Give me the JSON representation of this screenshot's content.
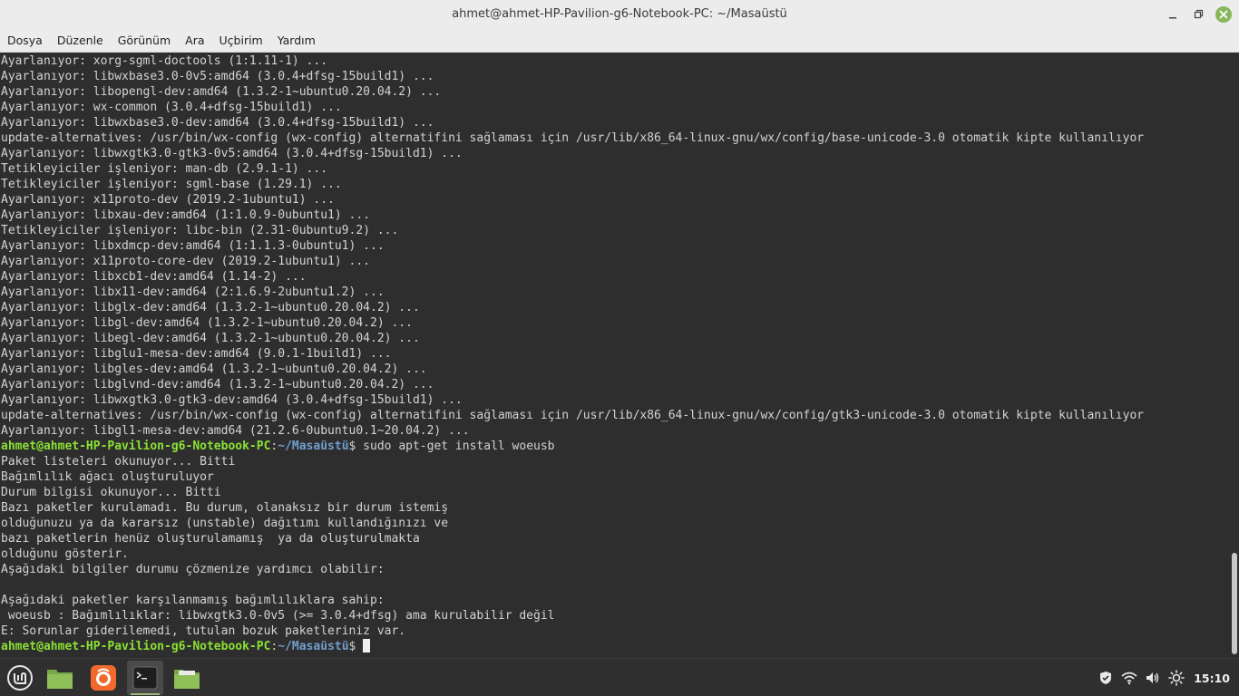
{
  "window": {
    "title": "ahmet@ahmet-HP-Pavilion-g6-Notebook-PC: ~/Masaüstü"
  },
  "menu": [
    "Dosya",
    "Düzenle",
    "Görünüm",
    "Ara",
    "Uçbirim",
    "Yardım"
  ],
  "terminal": {
    "lines": [
      {
        "type": "out",
        "text": "Ayarlanıyor: xorg-sgml-doctools (1:1.11-1) ..."
      },
      {
        "type": "out",
        "text": "Ayarlanıyor: libwxbase3.0-0v5:amd64 (3.0.4+dfsg-15build1) ..."
      },
      {
        "type": "out",
        "text": "Ayarlanıyor: libopengl-dev:amd64 (1.3.2-1~ubuntu0.20.04.2) ..."
      },
      {
        "type": "out",
        "text": "Ayarlanıyor: wx-common (3.0.4+dfsg-15build1) ..."
      },
      {
        "type": "out",
        "text": "Ayarlanıyor: libwxbase3.0-dev:amd64 (3.0.4+dfsg-15build1) ..."
      },
      {
        "type": "out",
        "text": "update-alternatives: /usr/bin/wx-config (wx-config) alternatifini sağlaması için /usr/lib/x86_64-linux-gnu/wx/config/base-unicode-3.0 otomatik kipte kullanılıyor"
      },
      {
        "type": "out",
        "text": "Ayarlanıyor: libwxgtk3.0-gtk3-0v5:amd64 (3.0.4+dfsg-15build1) ..."
      },
      {
        "type": "out",
        "text": "Tetikleyiciler işleniyor: man-db (2.9.1-1) ..."
      },
      {
        "type": "out",
        "text": "Tetikleyiciler işleniyor: sgml-base (1.29.1) ..."
      },
      {
        "type": "out",
        "text": "Ayarlanıyor: x11proto-dev (2019.2-1ubuntu1) ..."
      },
      {
        "type": "out",
        "text": "Ayarlanıyor: libxau-dev:amd64 (1:1.0.9-0ubuntu1) ..."
      },
      {
        "type": "out",
        "text": "Tetikleyiciler işleniyor: libc-bin (2.31-0ubuntu9.2) ..."
      },
      {
        "type": "out",
        "text": "Ayarlanıyor: libxdmcp-dev:amd64 (1:1.1.3-0ubuntu1) ..."
      },
      {
        "type": "out",
        "text": "Ayarlanıyor: x11proto-core-dev (2019.2-1ubuntu1) ..."
      },
      {
        "type": "out",
        "text": "Ayarlanıyor: libxcb1-dev:amd64 (1.14-2) ..."
      },
      {
        "type": "out",
        "text": "Ayarlanıyor: libx11-dev:amd64 (2:1.6.9-2ubuntu1.2) ..."
      },
      {
        "type": "out",
        "text": "Ayarlanıyor: libglx-dev:amd64 (1.3.2-1~ubuntu0.20.04.2) ..."
      },
      {
        "type": "out",
        "text": "Ayarlanıyor: libgl-dev:amd64 (1.3.2-1~ubuntu0.20.04.2) ..."
      },
      {
        "type": "out",
        "text": "Ayarlanıyor: libegl-dev:amd64 (1.3.2-1~ubuntu0.20.04.2) ..."
      },
      {
        "type": "out",
        "text": "Ayarlanıyor: libglu1-mesa-dev:amd64 (9.0.1-1build1) ..."
      },
      {
        "type": "out",
        "text": "Ayarlanıyor: libgles-dev:amd64 (1.3.2-1~ubuntu0.20.04.2) ..."
      },
      {
        "type": "out",
        "text": "Ayarlanıyor: libglvnd-dev:amd64 (1.3.2-1~ubuntu0.20.04.2) ..."
      },
      {
        "type": "out",
        "text": "Ayarlanıyor: libwxgtk3.0-gtk3-dev:amd64 (3.0.4+dfsg-15build1) ..."
      },
      {
        "type": "out",
        "text": "update-alternatives: /usr/bin/wx-config (wx-config) alternatifini sağlaması için /usr/lib/x86_64-linux-gnu/wx/config/gtk3-unicode-3.0 otomatik kipte kullanılıyor"
      },
      {
        "type": "out",
        "text": "Ayarlanıyor: libgl1-mesa-dev:amd64 (21.2.6-0ubuntu0.1~20.04.2) ..."
      },
      {
        "type": "prompt",
        "user": "ahmet@ahmet-HP-Pavilion-g6-Notebook-PC",
        "sep": ":",
        "path": "~/Masaüstü",
        "cmd": "$ sudo apt-get install woeusb"
      },
      {
        "type": "out",
        "text": "Paket listeleri okunuyor... Bitti"
      },
      {
        "type": "out",
        "text": "Bağımlılık ağacı oluşturuluyor"
      },
      {
        "type": "out",
        "text": "Durum bilgisi okunuyor... Bitti"
      },
      {
        "type": "out",
        "text": "Bazı paketler kurulamadı. Bu durum, olanaksız bir durum istemiş"
      },
      {
        "type": "out",
        "text": "olduğunuzu ya da kararsız (unstable) dağıtımı kullandığınızı ve"
      },
      {
        "type": "out",
        "text": "bazı paketlerin henüz oluşturulamamış  ya da oluşturulmakta"
      },
      {
        "type": "out",
        "text": "olduğunu gösterir."
      },
      {
        "type": "out",
        "text": "Aşağıdaki bilgiler durumu çözmenize yardımcı olabilir:"
      },
      {
        "type": "out",
        "text": ""
      },
      {
        "type": "out",
        "text": "Aşağıdaki paketler karşılanmamış bağımlılıklara sahip:"
      },
      {
        "type": "out",
        "text": " woeusb : Bağımlılıklar: libwxgtk3.0-0v5 (>= 3.0.4+dfsg) ama kurulabilir değil"
      },
      {
        "type": "out",
        "text": "E: Sorunlar giderilemedi, tutulan bozuk paketleriniz var."
      },
      {
        "type": "prompt",
        "user": "ahmet@ahmet-HP-Pavilion-g6-Notebook-PC",
        "sep": ":",
        "path": "~/Masaüstü",
        "cmd": "$ ",
        "cursor": true
      }
    ]
  },
  "taskbar": {
    "launchers": [
      {
        "name": "mint-menu-icon"
      },
      {
        "name": "files-folder-icon"
      },
      {
        "name": "firefox-icon"
      },
      {
        "name": "terminal-icon",
        "active": true
      },
      {
        "name": "folder-window-icon"
      }
    ],
    "clock": "15:10"
  },
  "colors": {
    "terminal_bg": "#2e2e2e",
    "prompt_user": "#8ae234",
    "prompt_path": "#729fcf",
    "close_button": "#86b85a"
  }
}
